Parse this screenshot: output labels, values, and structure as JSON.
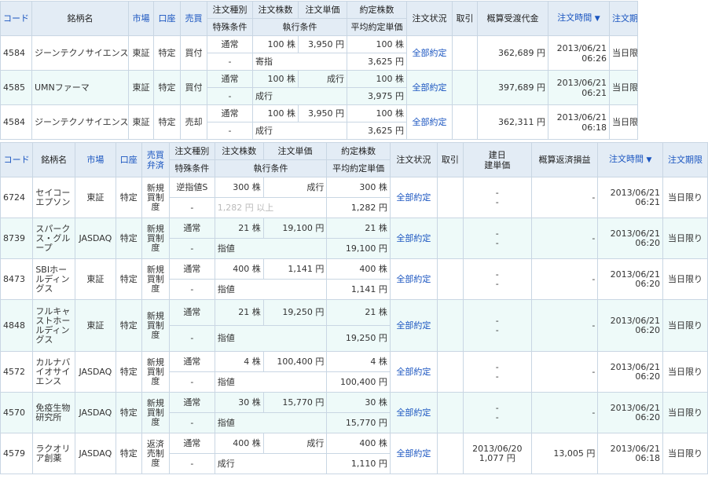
{
  "t1": {
    "headers": {
      "code": "コード",
      "name": "銘柄名",
      "market": "市場",
      "account": "口座",
      "side": "売買",
      "order_type": "注文種別",
      "special": "特殊条件",
      "qty": "注文株数",
      "cond": "執行条件",
      "price": "注文単価",
      "filled": "約定株数",
      "avg": "平均約定単価",
      "status": "注文状況",
      "cancel": "取引",
      "amount": "概算受渡代金",
      "time": "注文時間",
      "time_arrow": "▼",
      "expiry": "注文期限"
    },
    "rows": [
      {
        "code": "4584",
        "name": "ジーンテクノサイエンス",
        "market": "東証",
        "account": "特定",
        "side": "買付",
        "order_type": "通常",
        "special": "-",
        "qty": "100 株",
        "price": "3,950 円",
        "cond": "寄指",
        "filled": "100 株",
        "avg": "3,625 円",
        "status": "全部約定",
        "amount": "362,689 円",
        "date": "2013/06/21",
        "time": "06:26",
        "expiry": "当日限り"
      },
      {
        "code": "4585",
        "name": "UMNファーマ",
        "market": "東証",
        "account": "特定",
        "side": "買付",
        "order_type": "通常",
        "special": "-",
        "qty": "100 株",
        "price": "成行",
        "cond": "成行",
        "filled": "100 株",
        "avg": "3,975 円",
        "status": "全部約定",
        "amount": "397,689 円",
        "date": "2013/06/21",
        "time": "06:21",
        "expiry": "当日限り"
      },
      {
        "code": "4584",
        "name": "ジーンテクノサイエンス",
        "market": "東証",
        "account": "特定",
        "side": "売却",
        "order_type": "通常",
        "special": "-",
        "qty": "100 株",
        "price": "3,950 円",
        "cond": "成行",
        "filled": "100 株",
        "avg": "3,625 円",
        "status": "全部約定",
        "amount": "362,311 円",
        "date": "2013/06/21",
        "time": "06:18",
        "expiry": "当日限り"
      }
    ]
  },
  "t2": {
    "headers": {
      "code": "コード",
      "name": "銘柄名",
      "market": "市場",
      "account": "口座",
      "side1": "売買",
      "side2": "弁済",
      "order_type": "注文種別",
      "special": "特殊条件",
      "qty": "注文株数",
      "cond": "執行条件",
      "price": "注文単価",
      "filled": "約定株数",
      "avg": "平均約定単価",
      "status": "注文状況",
      "cancel": "取引",
      "build1": "建日",
      "build2": "建単価",
      "pl": "概算返済損益",
      "time": "注文時間",
      "time_arrow": "▼",
      "expiry": "注文期限"
    },
    "rows": [
      {
        "code": "6724",
        "name": "セイコーエプソン",
        "market": "東証",
        "account": "特定",
        "side": "新規買制度",
        "order_type": "逆指値S",
        "special": "-",
        "qty": "300 株",
        "price": "成行",
        "cond": "1,282 円 以上",
        "filled": "300 株",
        "avg": "1,282 円",
        "status": "全部約定",
        "build_date": "-",
        "build_price": "-",
        "pl": "-",
        "date": "2013/06/21",
        "time": "06:21",
        "expiry": "当日限り"
      },
      {
        "code": "8739",
        "name": "スパークス・グループ",
        "market": "JASDAQ",
        "account": "特定",
        "side": "新規買制度",
        "order_type": "通常",
        "special": "-",
        "qty": "21 株",
        "price": "19,100 円",
        "cond": "指値",
        "filled": "21 株",
        "avg": "19,100 円",
        "status": "全部約定",
        "build_date": "-",
        "build_price": "-",
        "pl": "-",
        "date": "2013/06/21",
        "time": "06:20",
        "expiry": "当日限り"
      },
      {
        "code": "8473",
        "name": "SBIホールディングス",
        "market": "東証",
        "account": "特定",
        "side": "新規買制度",
        "order_type": "通常",
        "special": "-",
        "qty": "400 株",
        "price": "1,141 円",
        "cond": "指値",
        "filled": "400 株",
        "avg": "1,141 円",
        "status": "全部約定",
        "build_date": "-",
        "build_price": "-",
        "pl": "-",
        "date": "2013/06/21",
        "time": "06:20",
        "expiry": "当日限り"
      },
      {
        "code": "4848",
        "name": "フルキャストホールディングス",
        "market": "東証",
        "account": "特定",
        "side": "新規買制度",
        "order_type": "通常",
        "special": "-",
        "qty": "21 株",
        "price": "19,250 円",
        "cond": "指値",
        "filled": "21 株",
        "avg": "19,250 円",
        "status": "全部約定",
        "build_date": "-",
        "build_price": "-",
        "pl": "-",
        "date": "2013/06/21",
        "time": "06:20",
        "expiry": "当日限り"
      },
      {
        "code": "4572",
        "name": "カルナバイオサイエンス",
        "market": "JASDAQ",
        "account": "特定",
        "side": "新規買制度",
        "order_type": "通常",
        "special": "-",
        "qty": "4 株",
        "price": "100,400 円",
        "cond": "指値",
        "filled": "4 株",
        "avg": "100,400 円",
        "status": "全部約定",
        "build_date": "-",
        "build_price": "-",
        "pl": "-",
        "date": "2013/06/21",
        "time": "06:20",
        "expiry": "当日限り"
      },
      {
        "code": "4570",
        "name": "免疫生物研究所",
        "market": "JASDAQ",
        "account": "特定",
        "side": "新規買制度",
        "order_type": "通常",
        "special": "-",
        "qty": "30 株",
        "price": "15,770 円",
        "cond": "指値",
        "filled": "30 株",
        "avg": "15,770 円",
        "status": "全部約定",
        "build_date": "-",
        "build_price": "-",
        "pl": "-",
        "date": "2013/06/21",
        "time": "06:20",
        "expiry": "当日限り"
      },
      {
        "code": "4579",
        "name": "ラクオリア創薬",
        "market": "JASDAQ",
        "account": "特定",
        "side": "返済売制度",
        "order_type": "通常",
        "special": "-",
        "qty": "400 株",
        "price": "成行",
        "cond": "成行",
        "filled": "400 株",
        "avg": "1,110 円",
        "status": "全部約定",
        "build_date": "2013/06/20",
        "build_price": "1,077 円",
        "pl": "13,005 円",
        "date": "2013/06/21",
        "time": "06:18",
        "expiry": "当日限り"
      }
    ]
  }
}
